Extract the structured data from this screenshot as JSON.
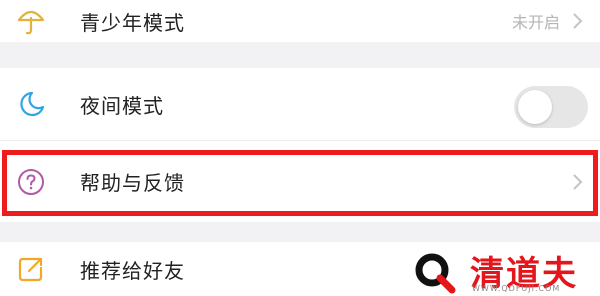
{
  "settings": {
    "teen_mode": {
      "label": "青少年模式",
      "status": "未开启",
      "icon": "umbrella-icon"
    },
    "night_mode": {
      "label": "夜间模式",
      "enabled": false,
      "icon": "moon-icon"
    },
    "help_feedback": {
      "label": "帮助与反馈",
      "icon": "question-circle-icon",
      "highlighted": true
    },
    "recommend": {
      "label": "推荐给好友",
      "icon": "share-icon"
    }
  },
  "colors": {
    "highlight_border": "#ee1c1c",
    "teen_icon": "#e2b23a",
    "moon_icon": "#2fa6e0",
    "help_icon": "#b15aa6",
    "share_icon": "#f0a828",
    "watermark_red": "#e4161b"
  },
  "watermark": {
    "title": "清道夫",
    "url": "WWW.QDFUJI.COM"
  }
}
